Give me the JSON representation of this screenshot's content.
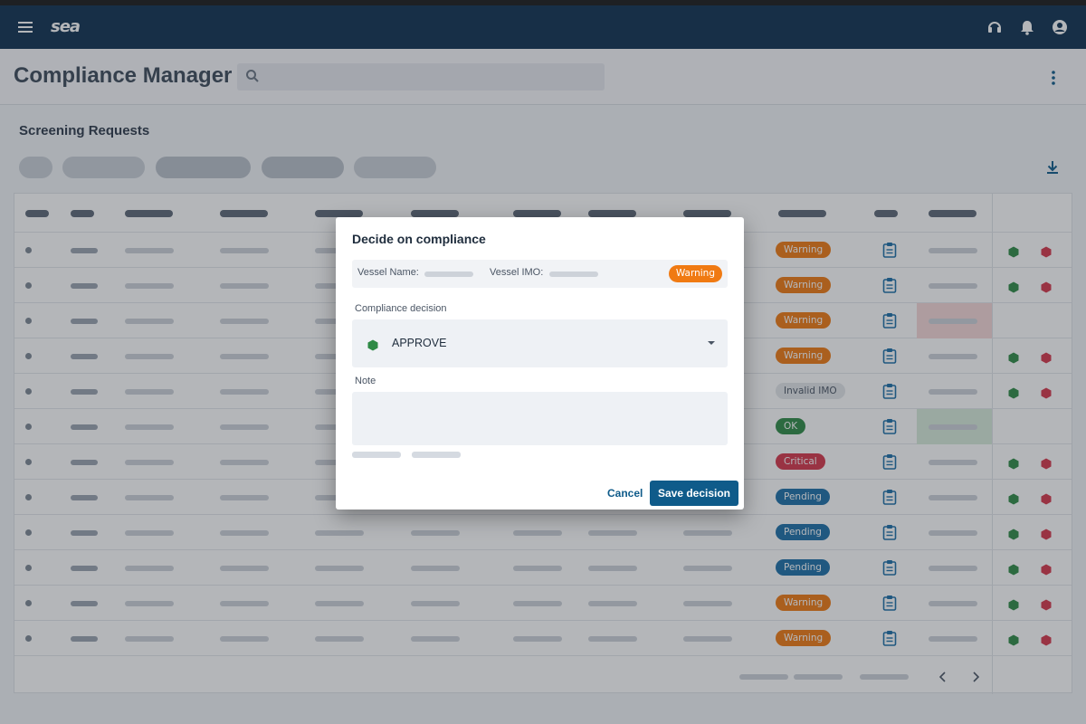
{
  "app": {
    "logo_text": "sea",
    "title": "Compliance Manager",
    "section_title": "Screening Requests",
    "brand_color": "#0f3150",
    "icons": {
      "menu": "menu-icon",
      "support": "headset-icon",
      "notifications": "bell-icon",
      "account": "account-icon",
      "search": "search-icon",
      "more": "more-vert-icon",
      "download": "download-icon"
    }
  },
  "table": {
    "status_badges": [
      {
        "label": "Warning",
        "color": "#f07a12"
      },
      {
        "label": "Warning",
        "color": "#f07a12"
      },
      {
        "label": "Warning",
        "color": "#f07a12"
      },
      {
        "label": "Warning",
        "color": "#f07a12"
      },
      {
        "label": "Invalid IMO",
        "color": "#e3e6ea"
      },
      {
        "label": "OK",
        "color": "#2e8a45"
      },
      {
        "label": "Critical",
        "color": "#d6364a"
      },
      {
        "label": "Pending",
        "color": "#1c6fa8"
      },
      {
        "label": "Pending",
        "color": "#1c6fa8"
      },
      {
        "label": "Pending",
        "color": "#1c6fa8"
      },
      {
        "label": "Warning",
        "color": "#f07a12"
      },
      {
        "label": "Warning",
        "color": "#f07a12"
      }
    ]
  },
  "dialog": {
    "title": "Decide on compliance",
    "vessel_name_label": "Vessel Name:",
    "vessel_imo_label": "Vessel IMO:",
    "status_badge": "Warning",
    "decision_label": "Compliance decision",
    "decision_value": "APPROVE",
    "note_label": "Note",
    "cancel_label": "Cancel",
    "save_label": "Save decision",
    "approve_color": "#2e8a45",
    "accent_color": "#0f5b8a"
  }
}
